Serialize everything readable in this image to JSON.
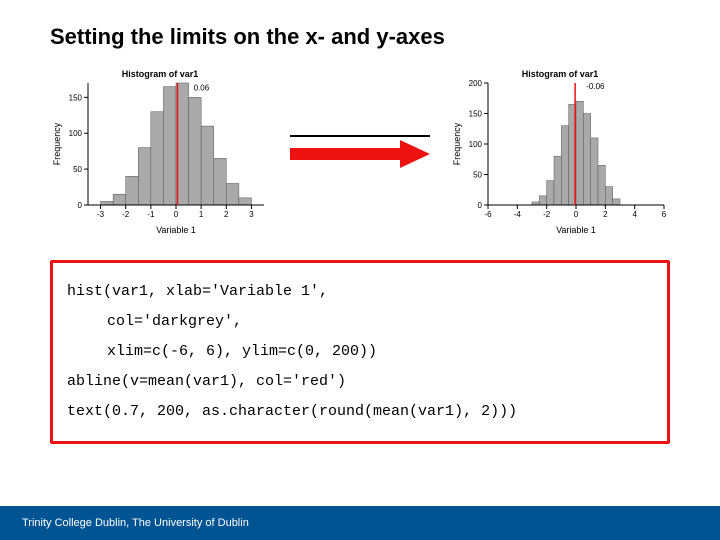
{
  "title": "Setting the limits on the x- and y-axes",
  "footer": "Trinity College Dublin, The University of Dublin",
  "code": {
    "l1": "hist(var1, xlab='Variable 1',",
    "l2": "col='darkgrey',",
    "l3": "xlim=c(-6, 6), ylim=c(0, 200))",
    "l4": "abline(v=mean(var1), col='red')",
    "l5": "text(0.7, 200, as.character(round(mean(var1), 2)))"
  },
  "chart_data": [
    {
      "type": "bar",
      "title": "Histogram of var1",
      "xlabel": "Variable 1",
      "ylabel": "Frequency",
      "xlim": [
        -3.5,
        3.5
      ],
      "ylim": [
        0,
        170
      ],
      "x_ticks": [
        -3,
        -2,
        -1,
        0,
        1,
        2,
        3
      ],
      "y_ticks": [
        0,
        50,
        100,
        150
      ],
      "bin_edges": [
        -3.0,
        -2.5,
        -2.0,
        -1.5,
        -1.0,
        -0.5,
        0.0,
        0.5,
        1.0,
        1.5,
        2.0,
        2.5,
        3.0
      ],
      "counts": [
        5,
        15,
        40,
        80,
        130,
        165,
        170,
        150,
        110,
        65,
        30,
        10
      ],
      "vline_x": 0.06,
      "annotation": {
        "text": "0.06",
        "x": 0.7,
        "y": 168
      }
    },
    {
      "type": "bar",
      "title": "Histogram of var1",
      "xlabel": "Variable 1",
      "ylabel": "Frequency",
      "xlim": [
        -6,
        6
      ],
      "ylim": [
        0,
        200
      ],
      "x_ticks": [
        -6,
        -4,
        -2,
        0,
        2,
        4,
        6
      ],
      "y_ticks": [
        0,
        50,
        100,
        150,
        200
      ],
      "bin_edges": [
        -3.0,
        -2.5,
        -2.0,
        -1.5,
        -1.0,
        -0.5,
        0.0,
        0.5,
        1.0,
        1.5,
        2.0,
        2.5,
        3.0
      ],
      "counts": [
        5,
        15,
        40,
        80,
        130,
        165,
        170,
        150,
        110,
        65,
        30,
        10
      ],
      "vline_x": -0.06,
      "annotation": {
        "text": "-0.06",
        "x": 0.7,
        "y": 200
      }
    }
  ]
}
